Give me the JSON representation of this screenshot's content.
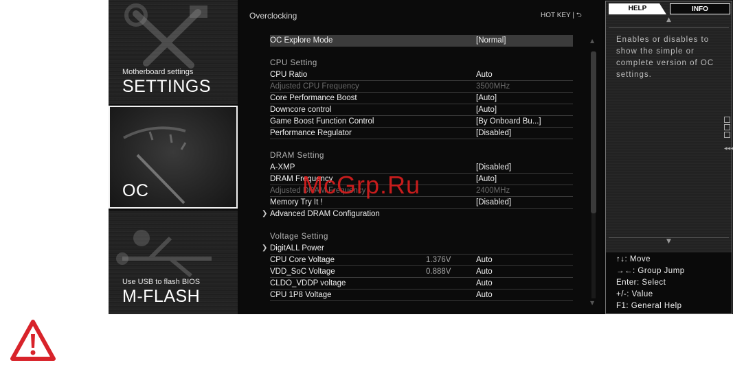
{
  "sidebar": {
    "settings": {
      "sub": "Motherboard settings",
      "big": "SETTINGS"
    },
    "oc": {
      "big": "OC"
    },
    "mflash": {
      "sub": "Use USB to flash BIOS",
      "big": "M-FLASH"
    }
  },
  "main": {
    "title": "Overclocking",
    "hotkey": "HOT KEY  |  ⮌",
    "rows": {
      "r0": {
        "label": "OC Explore Mode",
        "value": "[Normal]"
      },
      "s1": "CPU  Setting",
      "r1": {
        "label": "CPU Ratio",
        "value": "Auto"
      },
      "r2": {
        "label": "Adjusted CPU Frequency",
        "value": "3500MHz"
      },
      "r3": {
        "label": "Core Performance Boost",
        "value": "[Auto]"
      },
      "r4": {
        "label": "Downcore control",
        "value": "[Auto]"
      },
      "r5": {
        "label": "Game Boost Function Control",
        "value": "[By Onboard Bu...]"
      },
      "r6": {
        "label": "Performance Regulator",
        "value": "[Disabled]"
      },
      "s2": "DRAM  Setting",
      "r7": {
        "label": "A-XMP",
        "value": "[Disabled]"
      },
      "r8": {
        "label": "DRAM Frequency",
        "value": "[Auto]"
      },
      "r9": {
        "label": "Adjusted DRAM Frequency",
        "value": "2400MHz"
      },
      "r10": {
        "label": "Memory Try It !",
        "value": "[Disabled]"
      },
      "r11": {
        "label": "Advanced DRAM Configuration",
        "value": ""
      },
      "s3": "Voltage  Setting",
      "r12": {
        "label": "DigitALL Power",
        "value": ""
      },
      "r13": {
        "label": "CPU Core Voltage",
        "mid": "1.376V",
        "value": "Auto"
      },
      "r14": {
        "label": "VDD_SoC Voltage",
        "mid": "0.888V",
        "value": "Auto"
      },
      "r15": {
        "label": "CLDO_VDDP voltage",
        "value": "Auto"
      },
      "r16": {
        "label": "CPU 1P8 Voltage",
        "value": "Auto"
      }
    }
  },
  "help": {
    "tab_help": "HELP",
    "tab_info": "INFO",
    "text": "Enables or disables to show the simple or complete version of OC settings.",
    "keys": {
      "move": "↑↓: Move",
      "group": "→←: Group Jump",
      "enter": "Enter: Select",
      "value": "+/-: Value",
      "f1": "F1: General Help"
    }
  },
  "watermark": "McGrp.Ru",
  "colors": {
    "warning_red": "#d8232a",
    "watermark_red": "#d81e1e",
    "selected_row": "#3b3b3b"
  }
}
